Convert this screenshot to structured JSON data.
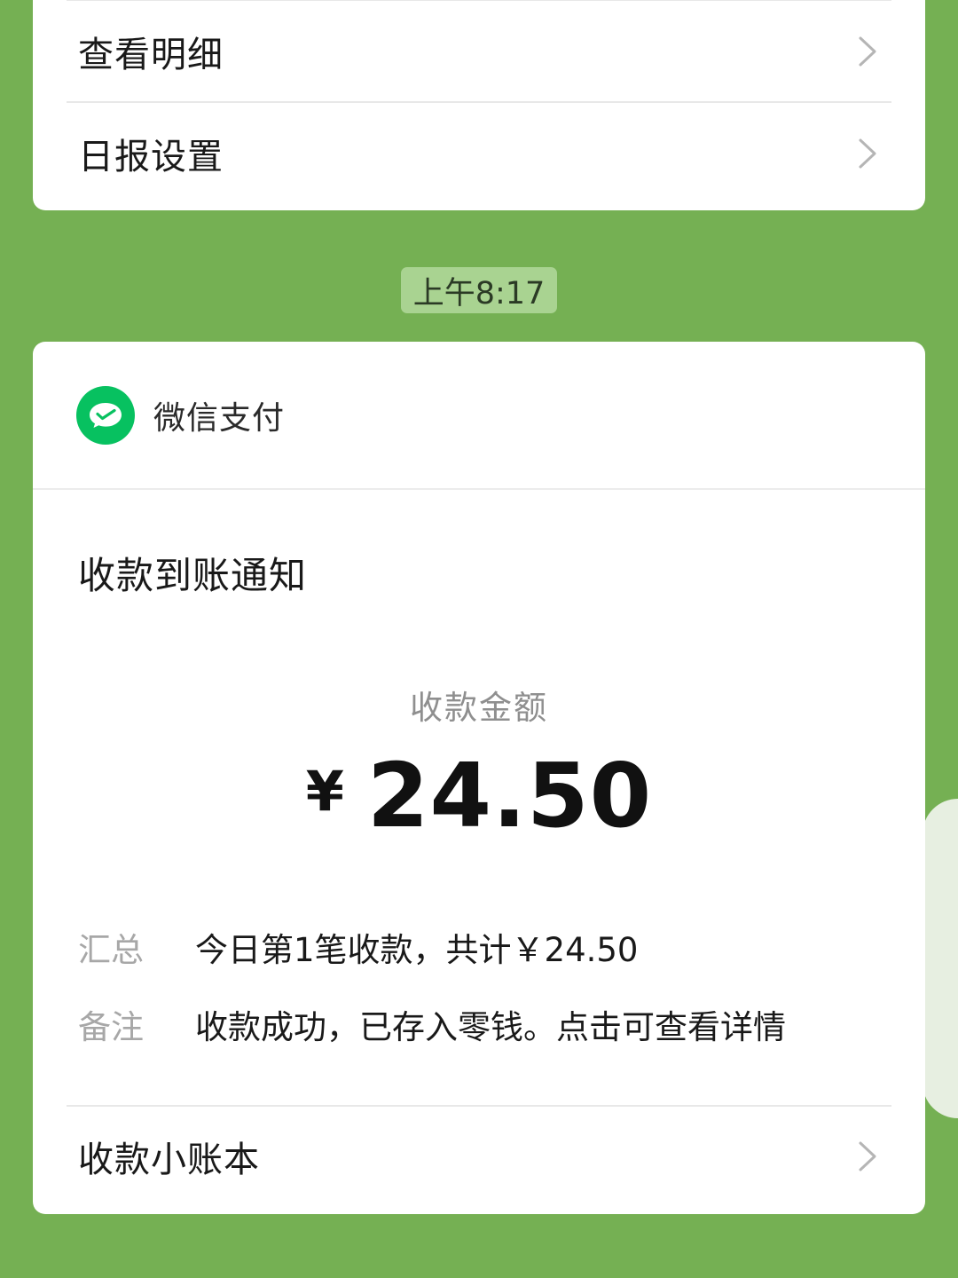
{
  "top_menu": {
    "items": [
      {
        "label": "查看明细"
      },
      {
        "label": "日报设置"
      }
    ]
  },
  "time_badge": "上午8:17",
  "notification": {
    "brand_name": "微信支付",
    "title": "收款到账通知",
    "amount_label": "收款金额",
    "currency_symbol": "¥",
    "amount": "24.50",
    "details": [
      {
        "key": "汇总",
        "value": "今日第1笔收款，共计￥24.50"
      },
      {
        "key": "备注",
        "value": "收款成功，已存入零钱。点击可查看详情"
      }
    ],
    "footer_link": "收款小账本"
  },
  "colors": {
    "background": "#75b053",
    "brand_green": "#07c160",
    "time_badge_bg": "#a9d391"
  },
  "icons": {
    "brand": "wechat-pay-icon",
    "row_arrow": "chevron-right-icon"
  }
}
